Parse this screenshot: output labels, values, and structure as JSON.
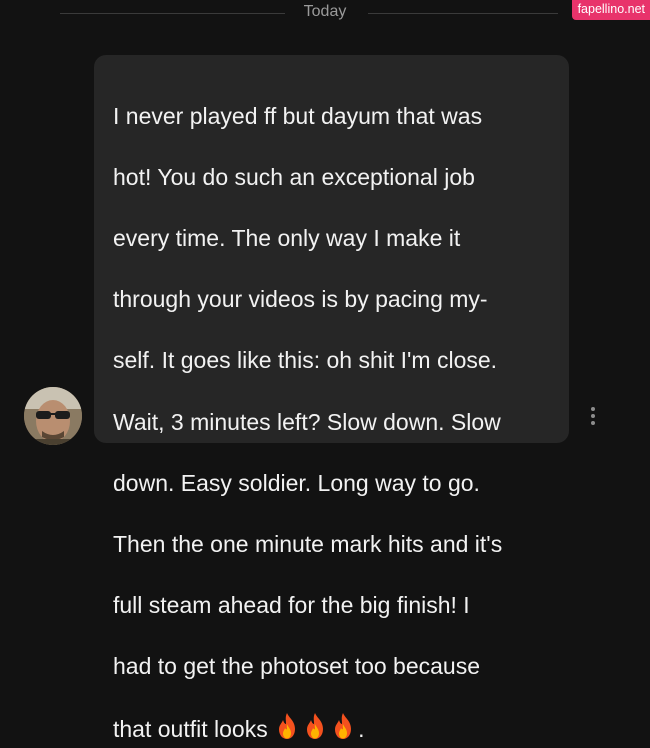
{
  "date_divider": {
    "label": "Today"
  },
  "watermark": {
    "text": "fapellino.net"
  },
  "message": {
    "text_lines": [
      "I never played ff but dayum that was",
      "hot! You do such an exceptional job",
      "every time. The only way I make it",
      "through your videos is by pacing my-",
      "self. It goes like this: oh shit I'm close.",
      "Wait, 3 minutes left? Slow down. Slow",
      "down. Easy soldier. Long way to go.",
      "Then the one minute mark hits and it's",
      "full steam ahead for the big finish! I",
      "had to get the photoset too because"
    ],
    "last_line_prefix": "that outfit looks ",
    "emoji": [
      "fire-icon",
      "fire-icon",
      "fire-icon"
    ],
    "last_line_suffix": "."
  },
  "colors": {
    "background": "#121212",
    "bubble": "#262626",
    "watermark": "#e8336b",
    "divider_text": "#9a9a9a"
  },
  "icons": {
    "more_menu": "vertical-ellipsis-icon",
    "avatar": "user-avatar"
  }
}
